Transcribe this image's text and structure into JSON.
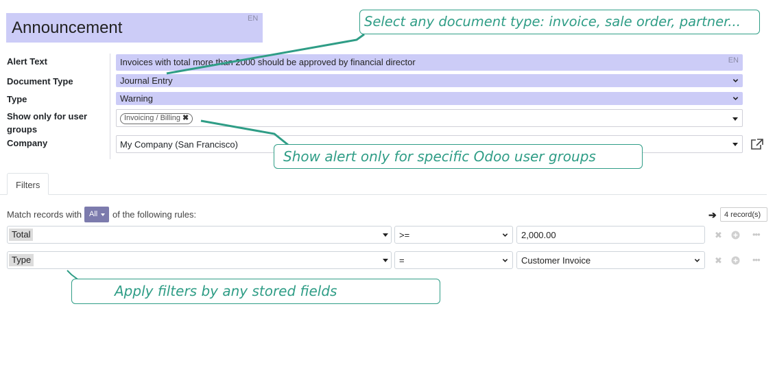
{
  "record": {
    "title": "Announcement",
    "title_lang": "EN"
  },
  "form": {
    "alert_text": {
      "label": "Alert Text",
      "value": "Invoices with total more than 2000 should be approved by financial director",
      "lang": "EN"
    },
    "document_type": {
      "label": "Document Type",
      "value": "Journal Entry"
    },
    "type": {
      "label": "Type",
      "value": "Warning"
    },
    "user_groups": {
      "label": "Show only for user groups",
      "tags": [
        "Invoicing / Billing"
      ]
    },
    "company": {
      "label": "Company",
      "value": "My Company (San Francisco)"
    }
  },
  "tabs": [
    {
      "label": "Filters",
      "active": true
    }
  ],
  "filters": {
    "match_prefix": "Match records with",
    "match_mode": "All",
    "match_suffix": "of the following rules:",
    "records_count": "4 record(s)",
    "rules": [
      {
        "field": "Total",
        "operator": ">=",
        "value": "2,000.00",
        "value_is_select": false
      },
      {
        "field": "Type",
        "operator": "=",
        "value": "Customer Invoice",
        "value_is_select": true
      }
    ]
  },
  "callouts": {
    "document_type": "Select any document type: invoice, sale order, partner...",
    "user_groups": "Show alert only for specific Odoo user groups",
    "filters": "Apply filters by any stored fields"
  },
  "colors": {
    "required_field_bg": "#ccccf7",
    "accent": "#7c7bad",
    "callout": "#2f9d86"
  },
  "icons": {
    "dropdown": "chevron-down-icon",
    "tag_remove": "close-icon",
    "external_link": "external-link-icon",
    "records_arrow": "arrow-right-icon",
    "rule_delete": "close-icon",
    "rule_add": "plus-circle-icon",
    "rule_more": "ellipsis-icon"
  }
}
